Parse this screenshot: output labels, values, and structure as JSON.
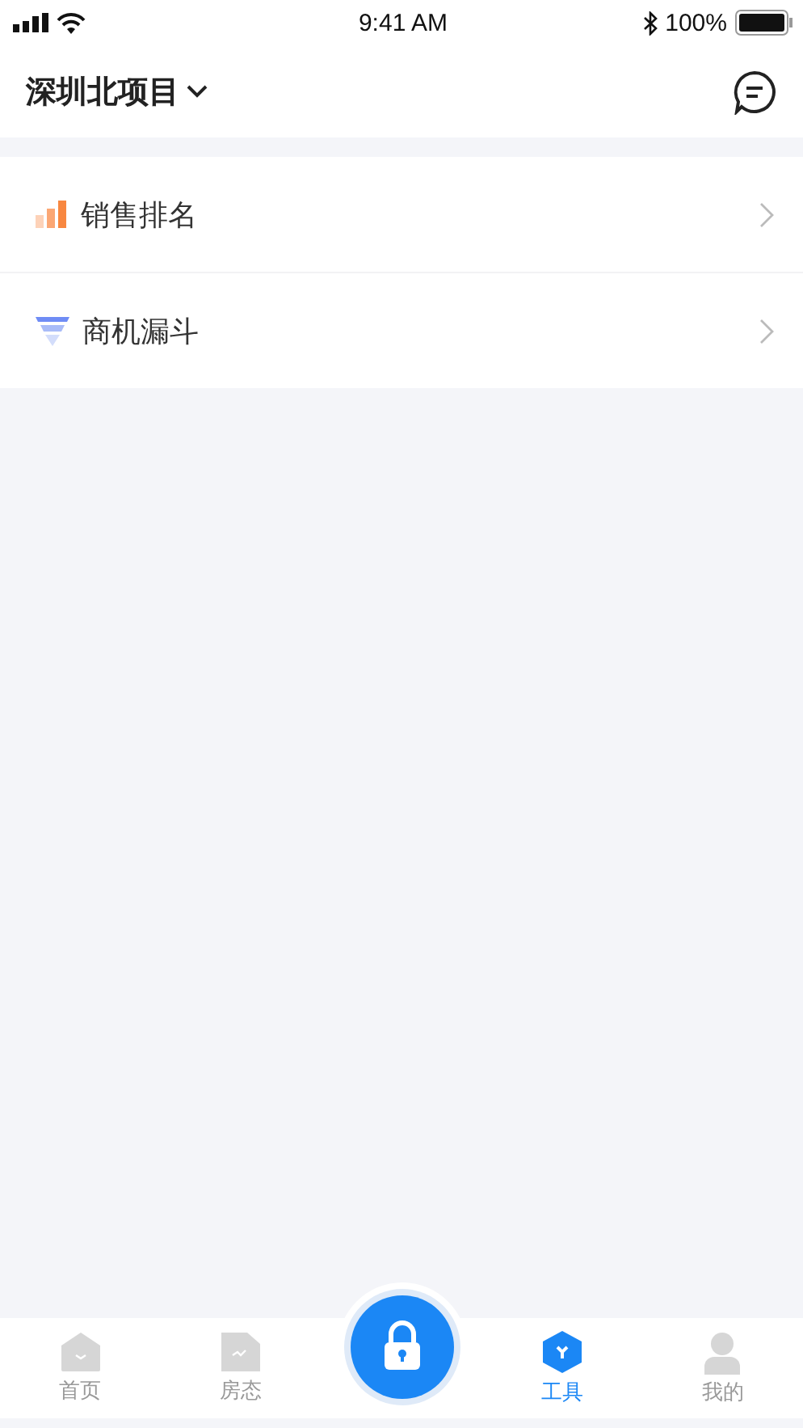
{
  "status_bar": {
    "time": "9:41 AM",
    "battery": "100%"
  },
  "header": {
    "title": "深圳北项目"
  },
  "menu": [
    {
      "kind": "ranking",
      "label": "销售排名"
    },
    {
      "kind": "funnel",
      "label": "商机漏斗"
    }
  ],
  "tab_bar": [
    {
      "kind": "home",
      "label": "首页",
      "selected": false
    },
    {
      "kind": "room",
      "label": "房态",
      "selected": false
    },
    {
      "kind": "lock",
      "selected": false
    },
    {
      "kind": "tools",
      "label": "工具",
      "selected": true
    },
    {
      "kind": "me",
      "label": "我的",
      "selected": false
    }
  ]
}
